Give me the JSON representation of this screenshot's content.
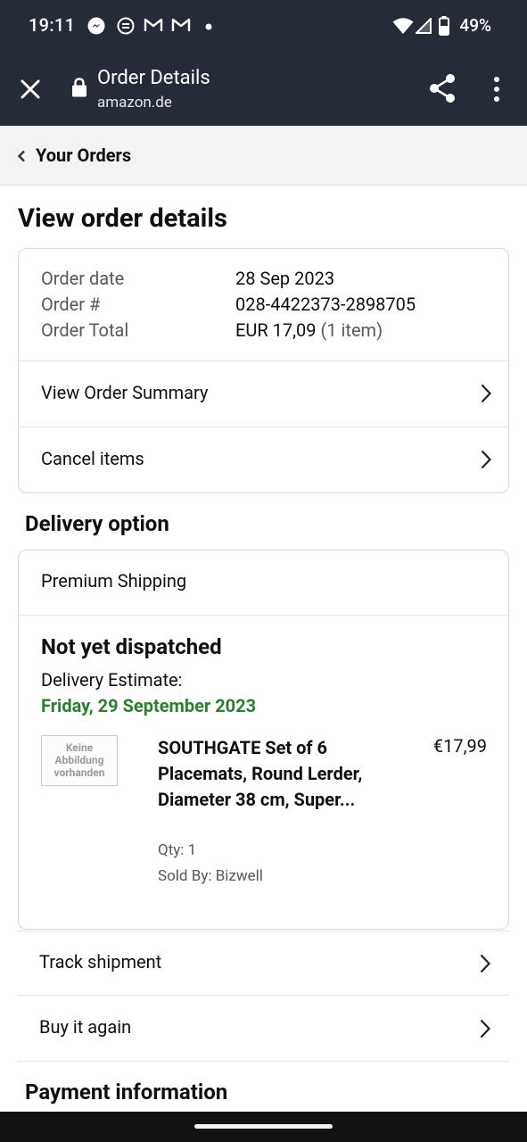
{
  "status_bar": {
    "time": "19:11",
    "battery": "49%",
    "notification_icons": [
      "messenger-icon",
      "chat-icon",
      "gmail-icon",
      "gmail-icon",
      "dot-icon"
    ]
  },
  "toolbar": {
    "title": "Order Details",
    "domain": "amazon.de"
  },
  "crumb": {
    "label": "Your Orders"
  },
  "page_title": "View order details",
  "order": {
    "date_label": "Order date",
    "date_value": "28 Sep 2023",
    "number_label": "Order #",
    "number_value": "028-4422373-2898705",
    "total_label": "Order Total",
    "total_value": "EUR 17,09",
    "total_items": "(1 item)",
    "summary_link": "View Order Summary",
    "cancel_link": "Cancel items"
  },
  "delivery": {
    "section_title": "Delivery option",
    "shipping_name": "Premium Shipping",
    "status": "Not yet dispatched",
    "estimate_label": "Delivery Estimate:",
    "estimate_date": "Friday, 29 September 2023",
    "item": {
      "image_placeholder": "Keine Abbildung vorhanden",
      "title": "SOUTHGATE Set of 6 Placemats, Round Lerder, Diameter 38 cm, Super...",
      "price": "€17,99",
      "qty": "Qty: 1",
      "seller": "Sold By: Bizwell"
    }
  },
  "actions": {
    "track": "Track shipment",
    "buy_again": "Buy it again"
  },
  "payment": {
    "section_title": "Payment information"
  },
  "colors": {
    "bar_bg": "#252b37",
    "green": "#2e7d32",
    "muted": "#565959",
    "border": "#d5d9d9"
  }
}
